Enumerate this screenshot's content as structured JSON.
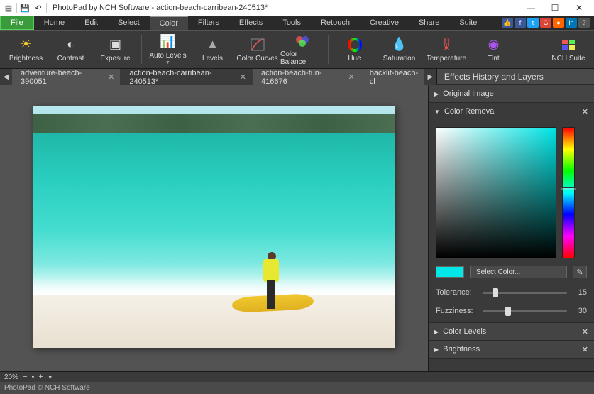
{
  "titlebar": {
    "title": "PhotoPad by NCH Software - action-beach-carribean-240513*"
  },
  "menu": {
    "items": [
      "File",
      "Home",
      "Edit",
      "Select",
      "Color",
      "Filters",
      "Effects",
      "Tools",
      "Retouch",
      "Creative",
      "Share",
      "Suite"
    ],
    "active_index": 0,
    "selected_tab_index": 4
  },
  "ribbon": {
    "buttons": [
      {
        "label": "Brightness",
        "icon": "sun"
      },
      {
        "label": "Contrast",
        "icon": "contrast"
      },
      {
        "label": "Exposure",
        "icon": "exposure"
      },
      {
        "label": "Auto Levels",
        "icon": "autolevels",
        "dropdown": true
      },
      {
        "label": "Levels",
        "icon": "levels"
      },
      {
        "label": "Color Curves",
        "icon": "curves"
      },
      {
        "label": "Color Balance",
        "icon": "balance"
      },
      {
        "label": "Hue",
        "icon": "hue"
      },
      {
        "label": "Saturation",
        "icon": "saturation"
      },
      {
        "label": "Temperature",
        "icon": "temperature"
      },
      {
        "label": "Tint",
        "icon": "tint"
      }
    ],
    "nch_label": "NCH Suite"
  },
  "tabs": [
    {
      "label": "adventure-beach-390051"
    },
    {
      "label": "action-beach-carribean-240513*",
      "active": true
    },
    {
      "label": "action-beach-fun-416676"
    },
    {
      "label": "backlit-beach-cl"
    }
  ],
  "side_panel": {
    "title": "Effects History and Layers",
    "sections": {
      "original": "Original Image",
      "color_removal": "Color Removal",
      "select_color": "Select Color...",
      "tolerance_label": "Tolerance:",
      "tolerance_value": "15",
      "fuzziness_label": "Fuzziness:",
      "fuzziness_value": "30",
      "color_levels": "Color Levels",
      "brightness": "Brightness"
    },
    "selected_color": "#00e8e8"
  },
  "zoom": {
    "level": "20%"
  },
  "status": {
    "text": "PhotoPad © NCH Software"
  }
}
